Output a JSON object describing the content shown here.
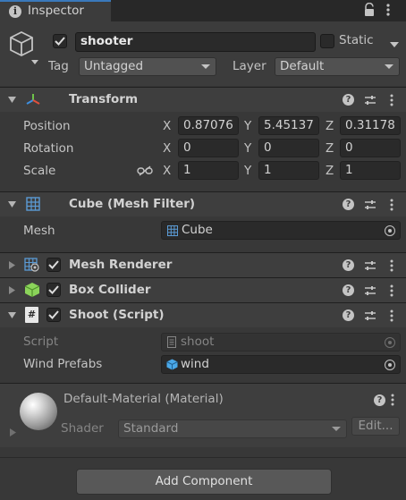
{
  "tab": {
    "title": "Inspector"
  },
  "object": {
    "name": "shooter",
    "static_label": "Static",
    "tag_label": "Tag",
    "tag_value": "Untagged",
    "layer_label": "Layer",
    "layer_value": "Default"
  },
  "transform": {
    "title": "Transform",
    "position_label": "Position",
    "rotation_label": "Rotation",
    "scale_label": "Scale",
    "axis_x": "X",
    "axis_y": "Y",
    "axis_z": "Z",
    "position": {
      "x": "0.87076",
      "y": "5.45137",
      "z": "0.31178"
    },
    "rotation": {
      "x": "0",
      "y": "0",
      "z": "0"
    },
    "scale": {
      "x": "1",
      "y": "1",
      "z": "1"
    }
  },
  "mesh_filter": {
    "title": "Cube (Mesh Filter)",
    "mesh_label": "Mesh",
    "mesh_value": "Cube"
  },
  "mesh_renderer": {
    "title": "Mesh Renderer"
  },
  "box_collider": {
    "title": "Box Collider"
  },
  "shoot_script": {
    "title": "Shoot (Script)",
    "script_label": "Script",
    "script_value": "shoot",
    "wind_label": "Wind Prefabs",
    "wind_value": "wind"
  },
  "material": {
    "title": "Default-Material (Material)",
    "shader_label": "Shader",
    "shader_value": "Standard",
    "edit_label": "Edit..."
  },
  "add_component": {
    "label": "Add Component"
  },
  "colors": {
    "accent": "#3a79bb",
    "background": "#383838",
    "header": "#3e3e3e",
    "field": "#2a2a2a"
  }
}
